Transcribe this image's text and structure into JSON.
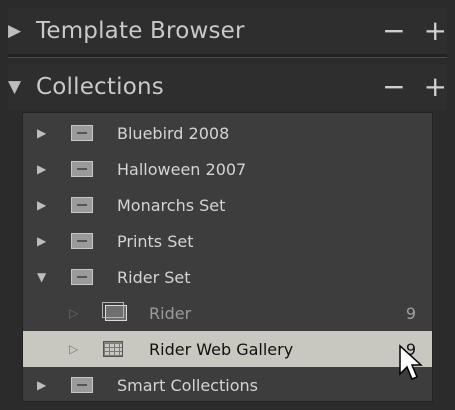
{
  "panels": {
    "template_browser": {
      "title": "Template Browser",
      "minus": "−",
      "plus": "+"
    },
    "collections": {
      "title": "Collections",
      "minus": "−",
      "plus": "+"
    }
  },
  "icons": {
    "collapsed": "▶",
    "expanded": "▼",
    "child_collapsed": "▷"
  },
  "collections": [
    {
      "label": "Bluebird 2008"
    },
    {
      "label": "Halloween 2007"
    },
    {
      "label": "Monarchs Set"
    },
    {
      "label": "Prints Set"
    },
    {
      "label": "Rider Set"
    }
  ],
  "children": [
    {
      "label": "Rider",
      "count": "9"
    },
    {
      "label": "Rider Web Gallery",
      "count": "9"
    }
  ],
  "smart": {
    "label": "Smart Collections"
  },
  "colors": {
    "selected_row": "#c8c8c0",
    "panel_bg": "#2e2e2e",
    "list_bg": "#3d3d3d"
  }
}
